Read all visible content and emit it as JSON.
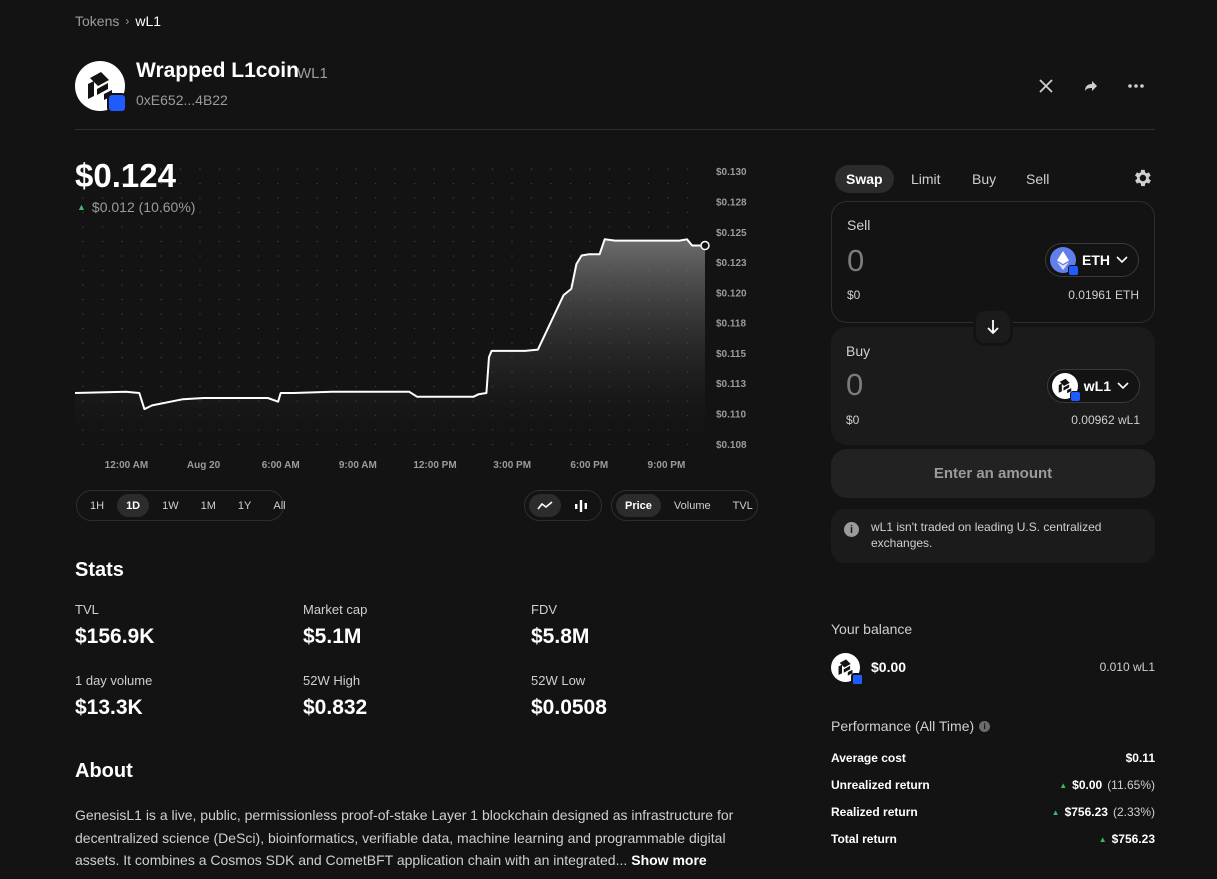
{
  "breadcrumb": {
    "parent": "Tokens",
    "current": "wL1"
  },
  "token": {
    "name": "Wrapped L1coin",
    "symbol": "WL1",
    "address": "0xE652...4B22",
    "logo_icon": "l1coin-logo-icon",
    "chain_badge_color": "#1f5cff"
  },
  "header_actions": [
    {
      "name": "x-share-icon",
      "glyph": "𝕏"
    },
    {
      "name": "share-arrow-icon",
      "glyph": "➦"
    },
    {
      "name": "more-icon",
      "glyph": "•••"
    }
  ],
  "price": {
    "current": "$0.124",
    "change": "$0.012 (10.60%)",
    "direction": "up"
  },
  "colors": {
    "up": "#40b66b",
    "background": "#131313",
    "accent_blue": "#1f5cff"
  },
  "chart_data": {
    "type": "area",
    "x_ticks": [
      "12:00 AM",
      "Aug 20",
      "6:00 AM",
      "9:00 AM",
      "12:00 PM",
      "3:00 PM",
      "6:00 PM",
      "9:00 PM"
    ],
    "y_ticks": [
      "$0.130",
      "$0.128",
      "$0.125",
      "$0.123",
      "$0.120",
      "$0.118",
      "$0.115",
      "$0.113",
      "$0.110",
      "$0.108"
    ],
    "ylim": [
      0.1075,
      0.1305
    ],
    "x_range_hours": [
      -2,
      22.5
    ],
    "series": [
      {
        "x": [
          -2,
          0.0,
          0.5,
          0.7,
          1.0,
          2.2,
          3.0,
          5.5,
          5.9,
          6.0,
          6.5,
          8.0,
          11.0,
          11.3,
          12.0,
          13.5,
          13.7,
          14.0,
          14.1,
          14.2,
          15.5,
          16.0,
          17.0,
          17.3,
          17.5,
          17.7,
          18.0,
          18.4,
          18.6,
          19.0,
          20.0,
          21.5,
          21.8,
          22.0,
          22.5
        ],
        "y": [
          0.1121,
          0.1122,
          0.1121,
          0.1108,
          0.1111,
          0.1116,
          0.1117,
          0.1117,
          0.1114,
          0.1121,
          0.1121,
          0.1122,
          0.1122,
          0.1118,
          0.1118,
          0.1118,
          0.112,
          0.1121,
          0.115,
          0.1155,
          0.1155,
          0.1156,
          0.12,
          0.1205,
          0.1225,
          0.1232,
          0.1233,
          0.1233,
          0.1245,
          0.1244,
          0.1244,
          0.1244,
          0.1245,
          0.124,
          0.124
        ]
      }
    ],
    "grid": "dotted"
  },
  "ranges": [
    "1H",
    "1D",
    "1W",
    "1M",
    "1Y",
    "All"
  ],
  "active_range": "1D",
  "chart_types": [
    {
      "name": "line-chart-icon",
      "active": true
    },
    {
      "name": "candlestick-icon",
      "active": false
    }
  ],
  "metrics": [
    "Price",
    "Volume",
    "TVL"
  ],
  "active_metric": "Price",
  "stats": {
    "title": "Stats",
    "items": [
      {
        "label": "TVL",
        "value": "$156.9K"
      },
      {
        "label": "Market cap",
        "value": "$5.1M"
      },
      {
        "label": "FDV",
        "value": "$5.8M"
      },
      {
        "label": "1 day volume",
        "value": "$13.3K"
      },
      {
        "label": "52W High",
        "value": "$0.832"
      },
      {
        "label": "52W Low",
        "value": "$0.0508"
      }
    ]
  },
  "about": {
    "title": "About",
    "text": "GenesisL1 is a live, public, permissionless proof-of-stake Layer 1 blockchain designed as infrastructure for decentralized science (DeSci), bioinformatics, verifiable data, machine learning and programmable digital assets. It combines a Cosmos SDK and CometBFT application chain with an integrated...",
    "show_more": "Show more"
  },
  "swap": {
    "tabs": [
      "Swap",
      "Limit",
      "Buy",
      "Sell"
    ],
    "active_tab": "Swap",
    "sell": {
      "label": "Sell",
      "amount": "0",
      "usd": "$0",
      "token": "ETH",
      "balance": "0.01961 ETH"
    },
    "buy": {
      "label": "Buy",
      "amount": "0",
      "usd": "$0",
      "token": "wL1",
      "balance": "0.00962 wL1"
    },
    "submit": "Enter an amount",
    "warning": "wL1 isn't traded on leading U.S. centralized exchanges."
  },
  "balance": {
    "title": "Your balance",
    "usd": "$0.00",
    "amount": "0.010 wL1"
  },
  "performance": {
    "title": "Performance (All Time)",
    "rows": [
      {
        "label": "Average cost",
        "value": "$0.11",
        "pct": "",
        "arrow": false
      },
      {
        "label": "Unrealized return",
        "value": "$0.00",
        "pct": "(11.65%)",
        "arrow": true
      },
      {
        "label": "Realized return",
        "value": "$756.23",
        "pct": "(2.33%)",
        "arrow": true
      },
      {
        "label": "Total return",
        "value": "$756.23",
        "pct": "",
        "arrow": true
      }
    ]
  }
}
